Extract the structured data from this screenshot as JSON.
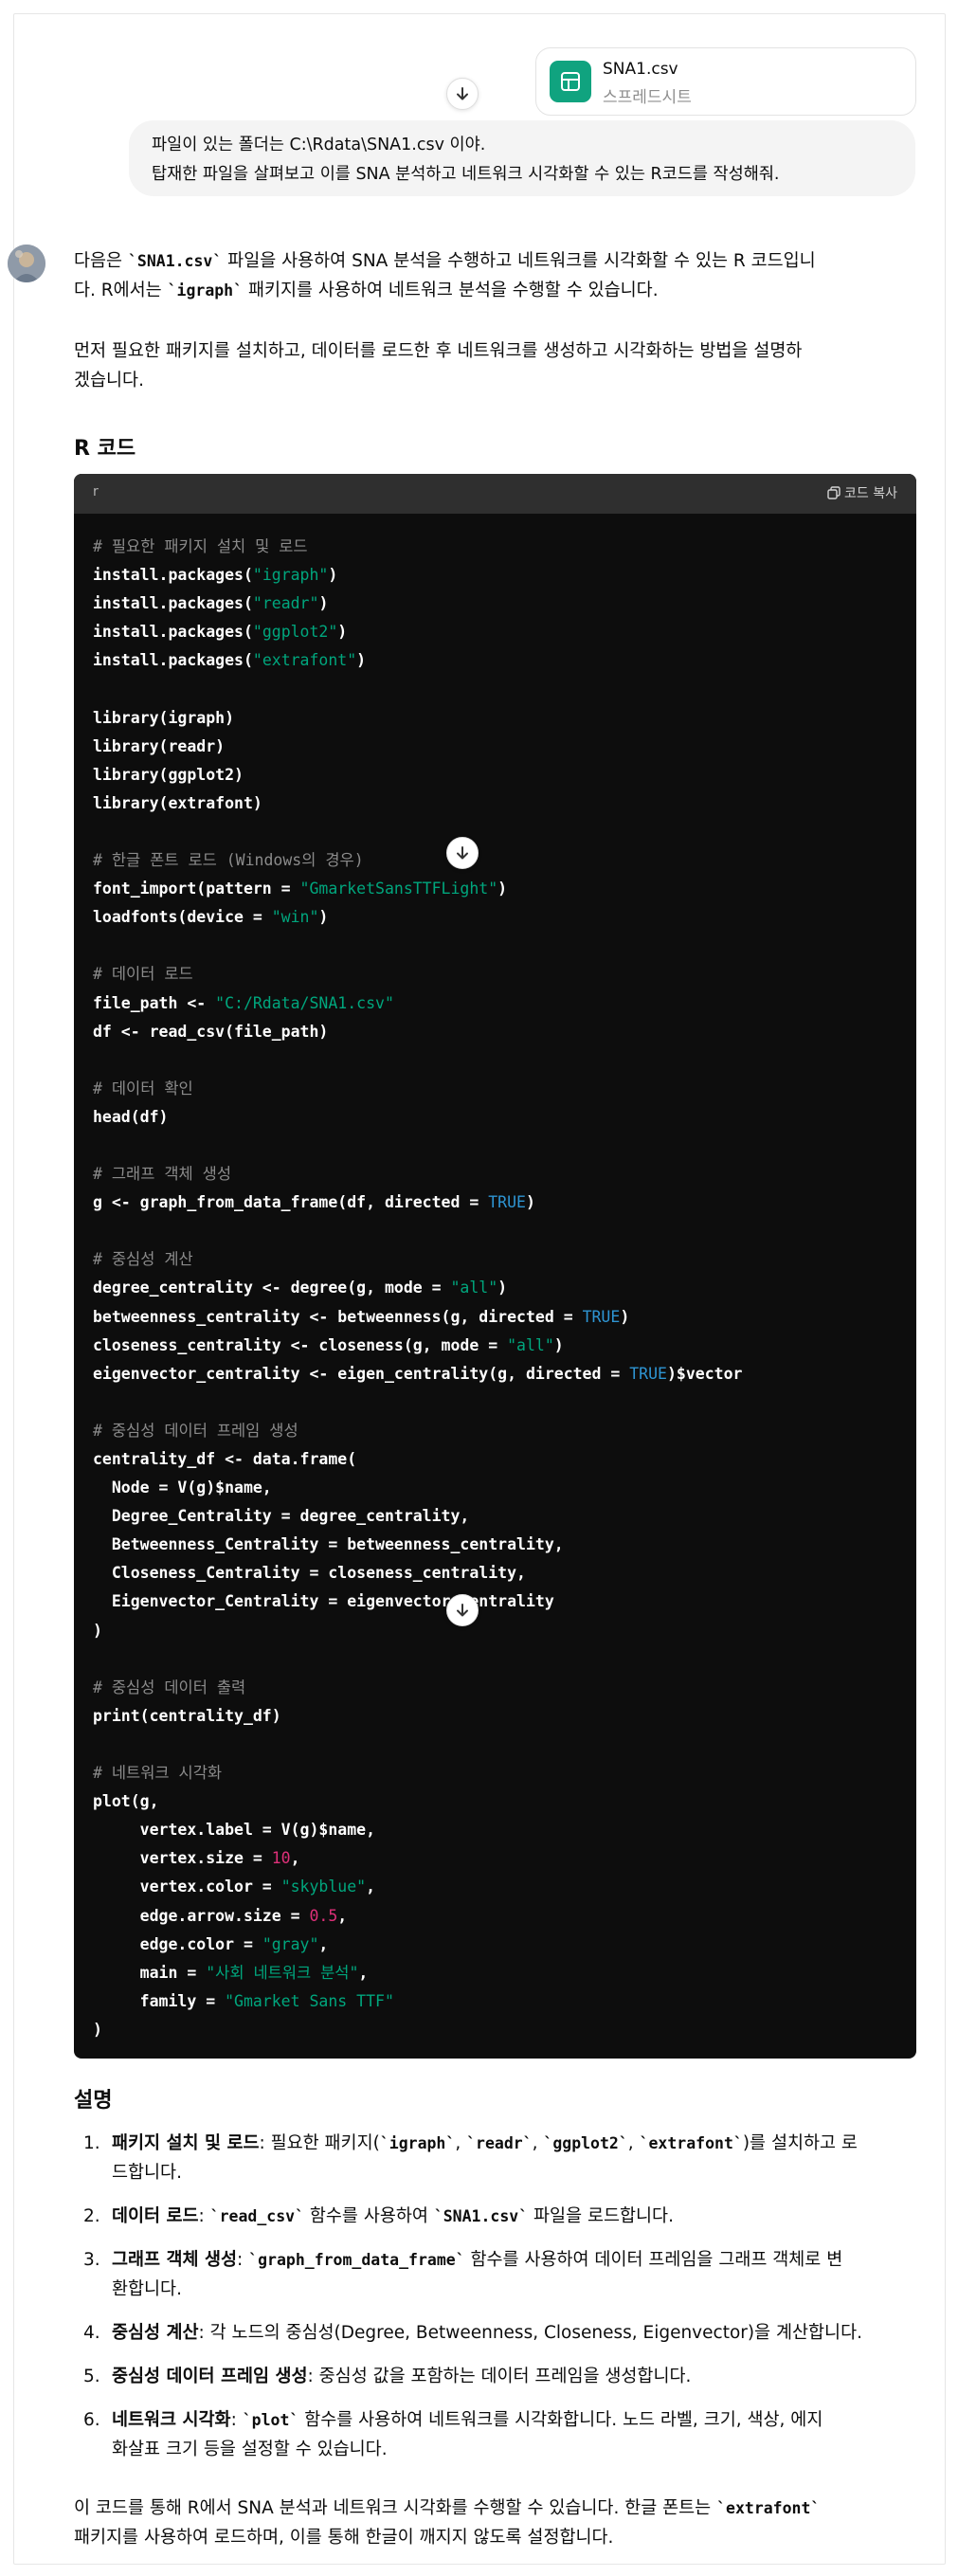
{
  "attachment": {
    "name": "SNA1.csv",
    "type": "스프레드시트"
  },
  "user_message": {
    "line1": "파일이 있는 폴더는 C:\\Rdata\\SNA1.csv 이야.",
    "line2": "탑재한 파일을 살펴보고 이를 SNA 분석하고 네트워크 시각화할 수 있는 R코드를 작성해줘."
  },
  "intro": {
    "p1a": "다음은 ",
    "p1b": "`SNA1.csv`",
    "p1c": " 파일을 사용하여 SNA 분석을 수행하고 네트워크를 시각화할 수 있는 R 코드입니",
    "p1d": "다. R에서는 ",
    "p1e": "`igraph`",
    "p1f": " 패키지를 사용하여 네트워크 분석을 수행할 수 있습니다.",
    "p2a": "먼저 필요한 패키지를 설치하고, 데이터를 로드한 후 네트워크를 생성하고 시각화하는 방법을 설명하",
    "p2b": "겠습니다."
  },
  "code_heading": "R 코드",
  "code_block": {
    "language": "r",
    "copy_label": "코드 복사",
    "lines": [
      [
        [
          "cm",
          "# 필요한 패키지 설치 및 로드"
        ]
      ],
      [
        [
          "t",
          "install.packages("
        ],
        [
          "st",
          "\"igraph\""
        ],
        [
          "t",
          ")"
        ]
      ],
      [
        [
          "t",
          "install.packages("
        ],
        [
          "st",
          "\"readr\""
        ],
        [
          "t",
          ")"
        ]
      ],
      [
        [
          "t",
          "install.packages("
        ],
        [
          "st",
          "\"ggplot2\""
        ],
        [
          "t",
          ")"
        ]
      ],
      [
        [
          "t",
          "install.packages("
        ],
        [
          "st",
          "\"extrafont\""
        ],
        [
          "t",
          ")"
        ]
      ],
      [],
      [
        [
          "t",
          "library(igraph)"
        ]
      ],
      [
        [
          "t",
          "library(readr)"
        ]
      ],
      [
        [
          "t",
          "library(ggplot2)"
        ]
      ],
      [
        [
          "t",
          "library(extrafont)"
        ]
      ],
      [],
      [
        [
          "cm",
          "# 한글 폰트 로드 (Windows의 경우)"
        ]
      ],
      [
        [
          "t",
          "font_import(pattern = "
        ],
        [
          "st",
          "\"GmarketSansTTFLight\""
        ],
        [
          "t",
          ")"
        ]
      ],
      [
        [
          "t",
          "loadfonts(device = "
        ],
        [
          "st",
          "\"win\""
        ],
        [
          "t",
          ")"
        ]
      ],
      [],
      [
        [
          "cm",
          "# 데이터 로드"
        ]
      ],
      [
        [
          "t",
          "file_path <- "
        ],
        [
          "st",
          "\"C:/Rdata/SNA1.csv\""
        ]
      ],
      [
        [
          "t",
          "df <- read_csv(file_path)"
        ]
      ],
      [],
      [
        [
          "cm",
          "# 데이터 확인"
        ]
      ],
      [
        [
          "t",
          "head(df)"
        ]
      ],
      [],
      [
        [
          "cm",
          "# 그래프 객체 생성"
        ]
      ],
      [
        [
          "t",
          "g <- graph_from_data_frame(df, directed = "
        ],
        [
          "kw",
          "TRUE"
        ],
        [
          "t",
          ")"
        ]
      ],
      [],
      [
        [
          "cm",
          "# 중심성 계산"
        ]
      ],
      [
        [
          "t",
          "degree_centrality <- degree(g, mode = "
        ],
        [
          "st",
          "\"all\""
        ],
        [
          "t",
          ")"
        ]
      ],
      [
        [
          "t",
          "betweenness_centrality <- betweenness(g, directed = "
        ],
        [
          "kw",
          "TRUE"
        ],
        [
          "t",
          ")"
        ]
      ],
      [
        [
          "t",
          "closeness_centrality <- closeness(g, mode = "
        ],
        [
          "st",
          "\"all\""
        ],
        [
          "t",
          ")"
        ]
      ],
      [
        [
          "t",
          "eigenvector_centrality <- eigen_centrality(g, directed = "
        ],
        [
          "kw",
          "TRUE"
        ],
        [
          "t",
          ")$vector"
        ]
      ],
      [],
      [
        [
          "cm",
          "# 중심성 데이터 프레임 생성"
        ]
      ],
      [
        [
          "t",
          "centrality_df <- data.frame("
        ]
      ],
      [
        [
          "t",
          "  Node = V(g)$name,"
        ]
      ],
      [
        [
          "t",
          "  Degree_Centrality = degree_centrality,"
        ]
      ],
      [
        [
          "t",
          "  Betweenness_Centrality = betweenness_centrality,"
        ]
      ],
      [
        [
          "t",
          "  Closeness_Centrality = closeness_centrality,"
        ]
      ],
      [
        [
          "t",
          "  Eigenvector_Centrality = eigenvector_centrality"
        ]
      ],
      [
        [
          "t",
          ")"
        ]
      ],
      [],
      [
        [
          "cm",
          "# 중심성 데이터 출력"
        ]
      ],
      [
        [
          "t",
          "print(centrality_df)"
        ]
      ],
      [],
      [
        [
          "cm",
          "# 네트워크 시각화"
        ]
      ],
      [
        [
          "t",
          "plot(g,"
        ]
      ],
      [
        [
          "t",
          "     vertex.label = V(g)$name,"
        ]
      ],
      [
        [
          "t",
          "     vertex.size = "
        ],
        [
          "nu",
          "10"
        ],
        [
          "t",
          ","
        ]
      ],
      [
        [
          "t",
          "     vertex.color = "
        ],
        [
          "st",
          "\"skyblue\""
        ],
        [
          "t",
          ","
        ]
      ],
      [
        [
          "t",
          "     edge.arrow.size = "
        ],
        [
          "nu",
          "0.5"
        ],
        [
          "t",
          ","
        ]
      ],
      [
        [
          "t",
          "     edge.color = "
        ],
        [
          "st",
          "\"gray\""
        ],
        [
          "t",
          ","
        ]
      ],
      [
        [
          "t",
          "     main = "
        ],
        [
          "st",
          "\"사회 네트워크 분석\""
        ],
        [
          "t",
          ","
        ]
      ],
      [
        [
          "t",
          "     family = "
        ],
        [
          "st",
          "\"Gmarket Sans TTF\""
        ]
      ],
      [
        [
          "t",
          ")"
        ]
      ]
    ]
  },
  "explain_heading": "설명",
  "list": [
    {
      "num": "1.",
      "title": "패키지 설치 및 로드",
      "l1": ": 필요한 패키지(",
      "c1": "`igraph`",
      "s1": ", ",
      "c2": "`readr`",
      "s2": ", ",
      "c3": "`ggplot2`",
      "s3": ", ",
      "c4": "`extrafont`",
      "l1b": ")를 설치하고 로",
      "l2": "드합니다."
    },
    {
      "num": "2.",
      "title": "데이터 로드",
      "a": ": ",
      "c1": "`read_csv`",
      "b": " 함수를 사용하여 ",
      "c2": "`SNA1.csv`",
      "d": " 파일을 로드합니다."
    },
    {
      "num": "3.",
      "title": "그래프 객체 생성",
      "a": ": ",
      "c1": "`graph_from_data_frame`",
      "b": " 함수를 사용하여 데이터 프레임을 그래프 객체로 변",
      "l2": "환합니다."
    },
    {
      "num": "4.",
      "title": "중심성 계산",
      "a": ": 각 노드의 중심성(Degree, Betweenness, Closeness, Eigenvector)을 계산합니다."
    },
    {
      "num": "5.",
      "title": "중심성 데이터 프레임 생성",
      "a": ": 중심성 값을 포함하는 데이터 프레임을 생성합니다."
    },
    {
      "num": "6.",
      "title": "네트워크 시각화",
      "a": ": ",
      "c1": "`plot`",
      "b": " 함수를 사용하여 네트워크를 시각화합니다. 노드 라벨, 크기, 색상, 에지",
      "l2": "화살표 크기 등을 설정할 수 있습니다."
    }
  ],
  "closing": {
    "a": "이 코드를 통해 R에서 SNA 분석과 네트워크 시각화를 수행할 수 있습니다. 한글 폰트는 ",
    "c": "`extrafont`",
    "l2": "패키지를 사용하여 로드하며, 이를 통해 한글이 깨지지 않도록 설정합니다."
  },
  "colors": {
    "sheet_icon": "#10a37f",
    "code_bg": "#0d0d0d",
    "code_header": "#2f2f2f",
    "string": "#00a67d",
    "keyword": "#2e95d3",
    "number": "#df3079",
    "comment": "#8b8b8b"
  },
  "icons": [
    "spreadsheet-icon",
    "arrow-down-icon",
    "copy-icon",
    "avatar"
  ]
}
